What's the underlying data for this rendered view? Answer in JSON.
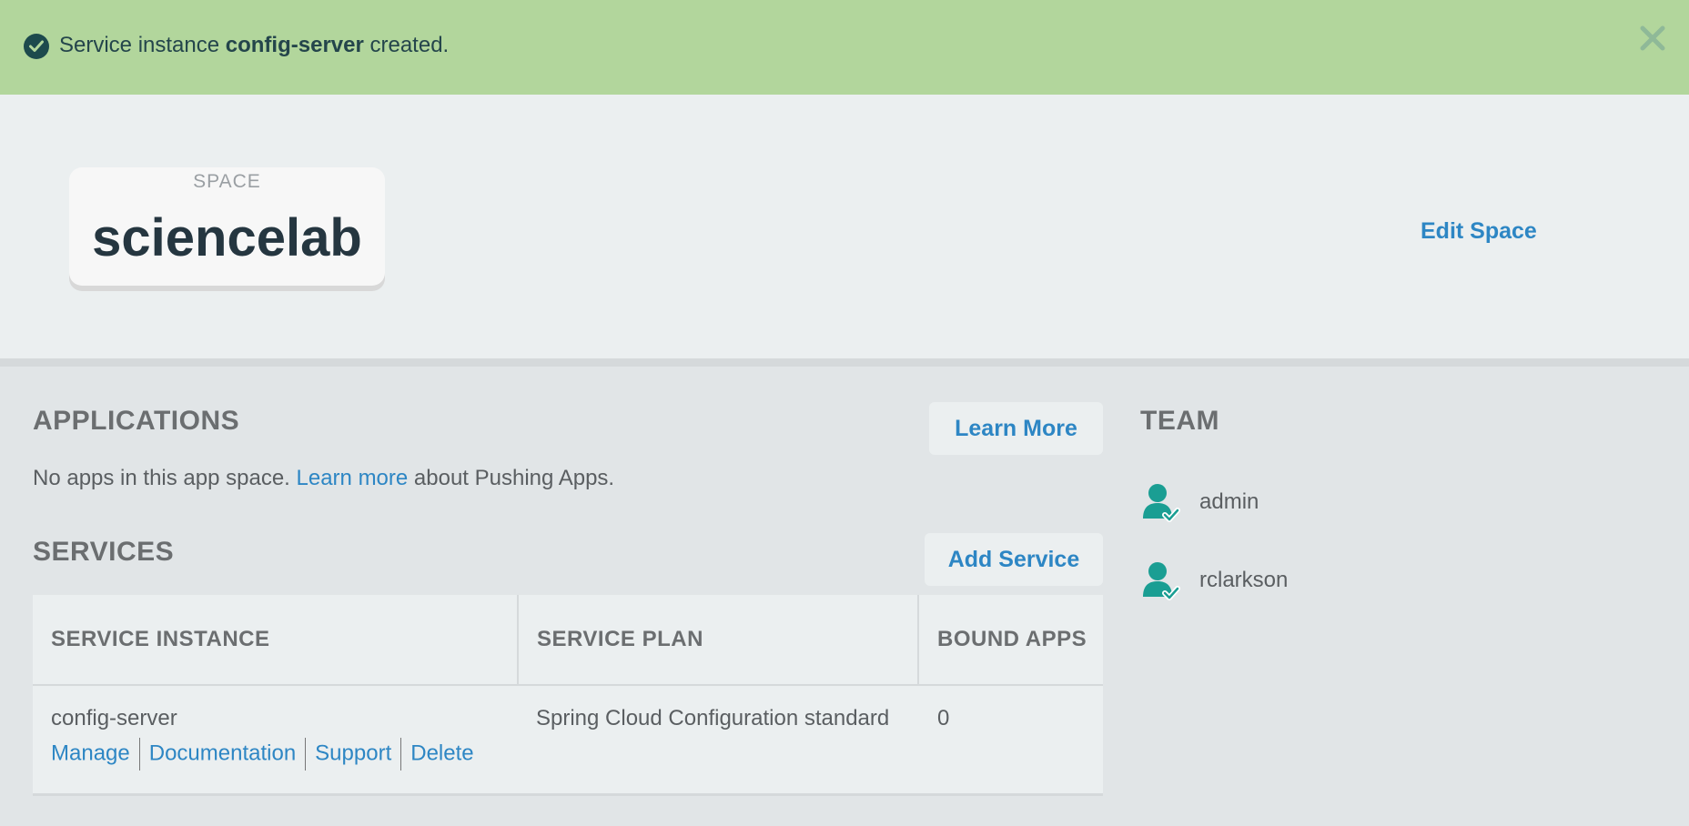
{
  "alert": {
    "prefix": "Service instance ",
    "service_name": "config-server",
    "suffix": " created.",
    "icons": {
      "status": "check-circle-icon",
      "close": "close-icon"
    },
    "colors": {
      "background": "#b2d69c",
      "text": "#24454b"
    }
  },
  "space": {
    "label": "SPACE",
    "name": "sciencelab",
    "edit_label": "Edit Space"
  },
  "applications": {
    "title": "APPLICATIONS",
    "learn_more_button": "Learn More",
    "empty_prefix": "No apps in this app space. ",
    "empty_link": "Learn more",
    "empty_suffix": " about Pushing Apps."
  },
  "services": {
    "title": "SERVICES",
    "add_button": "Add Service",
    "columns": [
      "SERVICE INSTANCE",
      "SERVICE PLAN",
      "BOUND APPS"
    ],
    "rows": [
      {
        "instance": "config-server",
        "plan": "Spring Cloud Configuration standard",
        "bound_apps": "0",
        "actions": [
          "Manage",
          "Documentation",
          "Support",
          "Delete"
        ]
      }
    ]
  },
  "team": {
    "title": "TEAM",
    "members": [
      {
        "name": "admin",
        "icon": "user-check-icon"
      },
      {
        "name": "rclarkson",
        "icon": "user-check-icon"
      }
    ]
  },
  "colors": {
    "accent": "#2d86c4",
    "heading": "#6b6e70",
    "team_icon": "#1a9e93"
  }
}
